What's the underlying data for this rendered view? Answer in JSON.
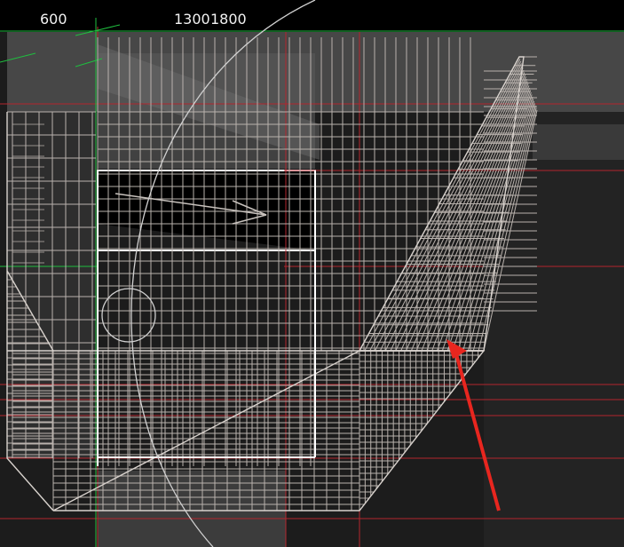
{
  "dimensions": {
    "dim_600": "600",
    "dim_1300": "1300",
    "dim_1800": "1800"
  },
  "colors": {
    "background": "#1c1c1c",
    "header_strip": "#000000",
    "rebar_line": "#b9b2ad",
    "highlight_white": "#ffffff",
    "axis_red": "#b3262e",
    "axis_green": "#1fbf3f",
    "arrow_red": "#e8261f",
    "panel_gray": "#3c3c3c",
    "opening_black": "#000000"
  },
  "icons": {
    "annotation_arrow": "red-arrow-icon",
    "reference_arc": "arc-guide",
    "reference_circle": "circle-marker"
  }
}
